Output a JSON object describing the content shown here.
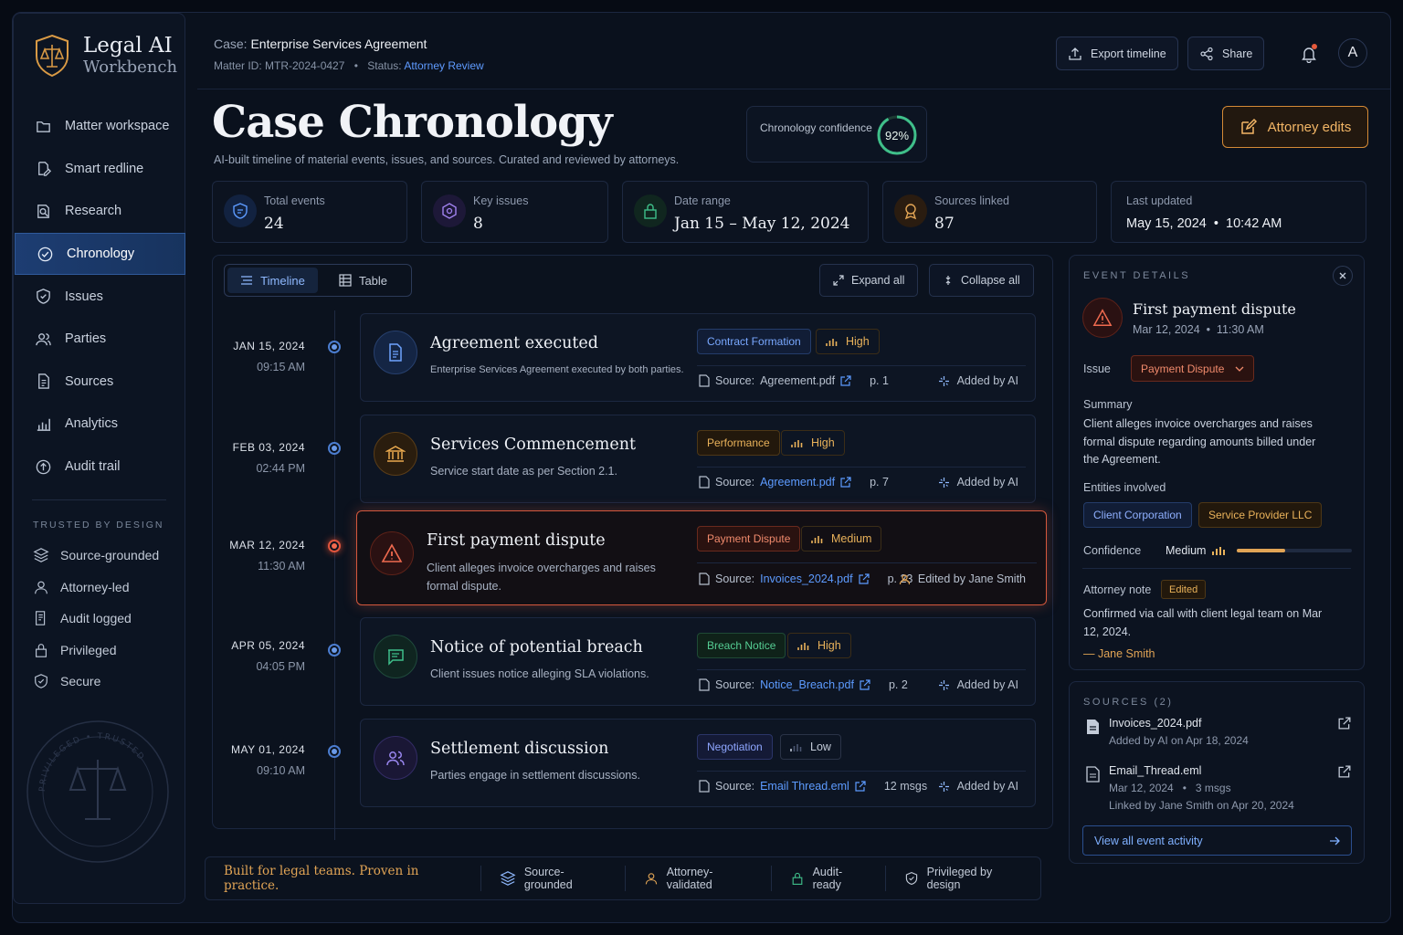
{
  "brand": {
    "line1": "Legal AI",
    "line2": "Workbench"
  },
  "nav": [
    {
      "label": "Matter workspace",
      "icon": "folder-icon"
    },
    {
      "label": "Smart redline",
      "icon": "pen-doc-icon"
    },
    {
      "label": "Research",
      "icon": "search-doc-icon"
    },
    {
      "label": "Chronology",
      "icon": "check-shield-icon",
      "active": true
    },
    {
      "label": "Issues",
      "icon": "shield-icon"
    },
    {
      "label": "Parties",
      "icon": "users-icon"
    },
    {
      "label": "Sources",
      "icon": "document-icon"
    },
    {
      "label": "Analytics",
      "icon": "bar-chart-icon"
    },
    {
      "label": "Audit trail",
      "icon": "audit-icon"
    }
  ],
  "trusted": {
    "heading": "TRUSTED BY DESIGN",
    "items": [
      "Source-grounded",
      "Attorney-led",
      "Audit logged",
      "Privileged",
      "Secure"
    ]
  },
  "seal": {
    "text": "PRIVILEGED • TRUSTED • SECURE"
  },
  "header": {
    "case_prefix": "Case:",
    "case_name": "Enterprise Services Agreement",
    "matter_id": "Matter ID: MTR-2024-0427",
    "status_label": "Status:",
    "status_value": "Attorney Review",
    "export_label": "Export timeline",
    "share_label": "Share",
    "avatar": "A"
  },
  "page": {
    "title": "Case Chronology",
    "subtitle": "AI-built timeline of material events, issues, and sources. Curated and reviewed by attorneys.",
    "confidence_label": "Chronology confidence",
    "confidence_value": "92%",
    "confidence_fraction": 0.92,
    "attorney_edits": "Attorney edits"
  },
  "stats": [
    {
      "label": "Total events",
      "value": "24"
    },
    {
      "label": "Key issues",
      "value": "8"
    },
    {
      "label": "Date range",
      "value": "Jan 15 – May 12, 2024"
    },
    {
      "label": "Sources linked",
      "value": "87"
    },
    {
      "label": "Last updated",
      "value": "May 15, 2024  •  10:42 AM"
    }
  ],
  "toolbar": {
    "timeline": "Timeline",
    "table": "Table",
    "expand": "Expand all",
    "collapse": "Collapse all"
  },
  "events": [
    {
      "date": "JAN 15, 2024",
      "time": "09:15 AM",
      "title": "Agreement executed",
      "desc": "Enterprise Services Agreement executed by both parties.",
      "tag": "Contract Formation",
      "priority": "High",
      "source_label": "Source:",
      "file": "Agreement.pdf",
      "page": "p. 1",
      "added": "Added by AI"
    },
    {
      "date": "FEB 03, 2024",
      "time": "02:44 PM",
      "title": "Services Commencement",
      "desc": "Service start date as per Section 2.1.",
      "tag": "Performance",
      "priority": "High",
      "source_label": "Source:",
      "file": "Agreement.pdf",
      "page": "p. 7",
      "added": "Added by AI"
    },
    {
      "date": "MAR 12, 2024",
      "time": "11:30 AM",
      "title": "First payment dispute",
      "desc": "Client alleges invoice overcharges and raises formal dispute.",
      "tag": "Payment Dispute",
      "priority": "Medium",
      "source_label": "Source:",
      "file": "Invoices_2024.pdf",
      "page": "p. 23",
      "added": "Edited by Jane Smith"
    },
    {
      "date": "APR 05, 2024",
      "time": "04:05 PM",
      "title": "Notice of potential breach",
      "desc": "Client issues notice alleging SLA violations.",
      "tag": "Breach Notice",
      "priority": "High",
      "source_label": "Source:",
      "file": "Notice_Breach.pdf",
      "page": "p. 2",
      "added": "Added by AI"
    },
    {
      "date": "MAY 01, 2024",
      "time": "09:10 AM",
      "title": "Settlement discussion",
      "desc": "Parties engage in settlement discussions.",
      "tag": "Negotiation",
      "priority": "Low",
      "source_label": "Source:",
      "file": "Email Thread.eml",
      "page": "12 msgs",
      "added": "Added by AI"
    }
  ],
  "details": {
    "heading": "EVENT DETAILS",
    "title": "First payment dispute",
    "datetime": "Mar 12, 2024  •  11:30 AM",
    "issue_label": "Issue",
    "issue_value": "Payment Dispute",
    "summary_label": "Summary",
    "summary": "Client alleges invoice overcharges and raises formal dispute regarding amounts billed under the Agreement.",
    "entities_label": "Entities involved",
    "entities": [
      "Client Corporation",
      "Service Provider LLC"
    ],
    "confidence_label": "Confidence",
    "confidence_value": "Medium",
    "confidence_fraction": 0.42,
    "note_label": "Attorney note",
    "note_badge": "Edited",
    "note": "Confirmed via call with client legal team on Mar 12, 2024.",
    "note_author": "— Jane Smith"
  },
  "sources": {
    "heading": "SOURCES (2)",
    "items": [
      {
        "name": "Invoices_2024.pdf",
        "meta1": "Added by AI on Apr 18, 2024",
        "meta2": ""
      },
      {
        "name": "Email_Thread.eml",
        "meta1": "Mar 12, 2024   •   3 msgs",
        "meta2": "Linked by Jane Smith on Apr 20, 2024"
      }
    ],
    "view_all": "View all event activity"
  },
  "footer": {
    "tagline": "Built for legal teams. Proven in practice.",
    "items": [
      "Source-grounded",
      "Attorney-validated",
      "Audit-ready",
      "Privileged by design"
    ]
  },
  "colors": {
    "accent": "#5d9bff",
    "amber": "#e1a455",
    "danger": "#e0553d",
    "success": "#3fbf8a"
  }
}
